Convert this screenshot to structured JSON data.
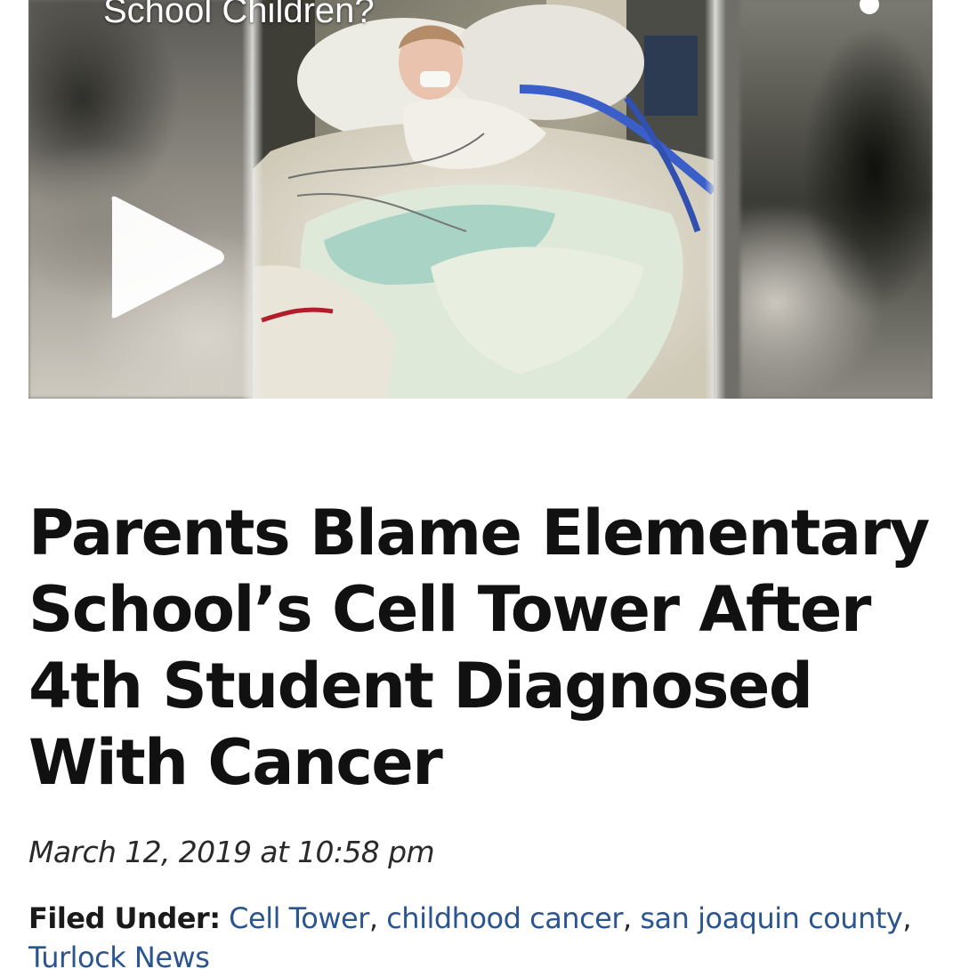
{
  "video": {
    "title": "School Children?",
    "play_icon": "play-icon",
    "menu_icon": "more-options-icon"
  },
  "article": {
    "headline": "Parents Blame Elementary School’s Cell Tower After 4th Student Diagnosed With Cancer",
    "date": "March 12, 2019 at 10:58 pm",
    "filed_under_label": "Filed Under:",
    "separator": ",",
    "tags": [
      "Cell Tower",
      "childhood cancer",
      "san joaquin county",
      "Turlock News"
    ]
  },
  "colors": {
    "link": "#2b5590",
    "headline": "#111111"
  }
}
